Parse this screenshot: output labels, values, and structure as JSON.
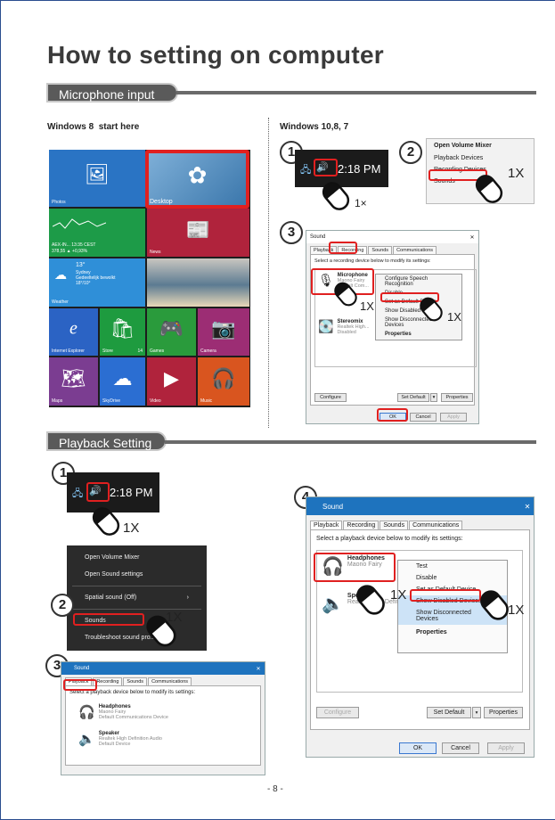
{
  "title": "How to setting on computer",
  "sections": {
    "mic": "Microphone input",
    "playback": "Playback Setting"
  },
  "win8": {
    "heading": "Windows 8",
    "sub": "start here"
  },
  "win10": {
    "heading": "Windows 10,8, 7"
  },
  "tiles": {
    "photos": "Photos",
    "desktop": "Desktop",
    "finance_line1": "AEX-IN... 13:35 CEST",
    "finance_line2": "378,55 ▲ +0,93%",
    "news": "News",
    "weather_temp": "13°",
    "weather_city": "Sydney",
    "weather_desc": "Gedeeltelijk bewolkt",
    "weather_range": "18°/10°",
    "weather": "Weather",
    "ie": "Internet Explorer",
    "store": "Store",
    "store_count": "14",
    "games": "Games",
    "camera": "Camera",
    "maps": "Maps",
    "skydrive": "SkyDrive",
    "video": "Video",
    "music": "Music"
  },
  "steps": {
    "one": "1",
    "two": "2",
    "three": "3",
    "four": "4"
  },
  "clock": "2:18 PM",
  "clicks": {
    "once_x": "1×",
    "once": "1X"
  },
  "mic_menu": {
    "open_mixer": "Open Volume Mixer",
    "playback_devices": "Playback Devices",
    "recording_devices": "Recording Devices",
    "sounds": "Sounds"
  },
  "sound_dialog": {
    "title": "Sound",
    "close": "✕",
    "tabs": [
      "Playback",
      "Recording",
      "Sounds",
      "Communications"
    ],
    "recording_prompt": "Select a recording device below to modify its settings:",
    "playback_prompt": "Select a playback device below to modify its settings:",
    "mic_name": "Microphone",
    "mic_sub1": "Maono Fairy",
    "mic_sub2": "Default Com...",
    "stereo_name": "Stereomix",
    "stereo_sub1": "Realtek High...",
    "stereo_sub2": "Disabled",
    "headphones_name": "Headphones",
    "headphones_sub1": "Maono Fairy",
    "headphones_sub2": "Default Communications Device",
    "speaker_name": "Speaker",
    "speaker_sub1": "Realtek High Definition Audio",
    "speaker_sub2": "Default Device",
    "configure": "Configure",
    "set_default": "Set Default",
    "properties": "Properties",
    "ok": "OK",
    "cancel": "Cancel",
    "apply": "Apply"
  },
  "rec_ctx": {
    "speech": "Configure Speech Recognition",
    "disable": "Disable",
    "set_default": "Set as Default Device",
    "show_disabled": "Show Disabled Devices",
    "show_disconnected": "Show Disconnected Devices",
    "properties": "Properties"
  },
  "play_ctx": {
    "test": "Test",
    "disable": "Disable",
    "set_default": "Set as Default Device",
    "show_disabled": "Show Disabled Devices",
    "show_disconnected": "Show Disconnected Devices",
    "properties": "Properties"
  },
  "speaker_menu": {
    "open_mixer": "Open Volume Mixer",
    "open_settings": "Open Sound settings",
    "spatial": "Spatial sound (Off)",
    "sounds": "Sounds",
    "troubleshoot": "Troubleshoot sound pro..."
  },
  "page_number": "- 8 -",
  "colors": {
    "accent_red": "#e02020",
    "win_blue": "#1e73be",
    "frame_blue": "#2a4d8f"
  }
}
